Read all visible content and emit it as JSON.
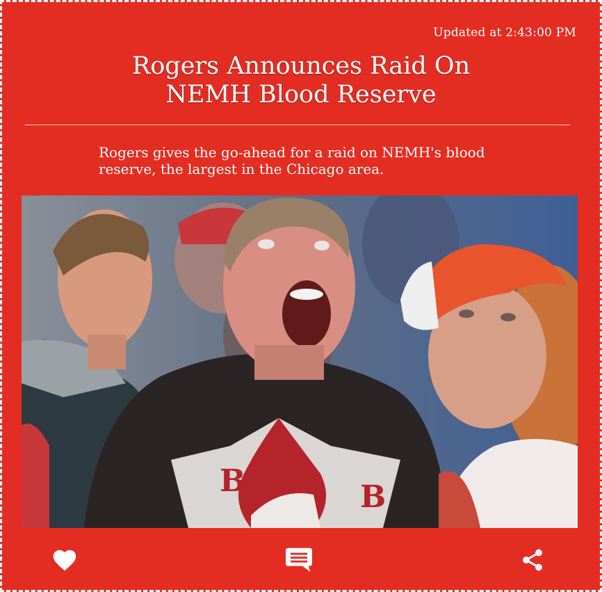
{
  "article": {
    "updated_label": "Updated at 2:43:00 PM",
    "headline_line1": "Rogers Announces Raid On",
    "headline_line2": "NEMH Blood Reserve",
    "summary": "Rogers gives the go-ahead for a raid on NEMH's blood reserve, the largest in the Chicago area.",
    "shirt_letter": "B"
  },
  "actions": {
    "like_icon": "heart-icon",
    "comment_icon": "comment-icon",
    "share_icon": "share-icon"
  },
  "theme": {
    "background": "#e42d22",
    "text": "#ffffff"
  }
}
